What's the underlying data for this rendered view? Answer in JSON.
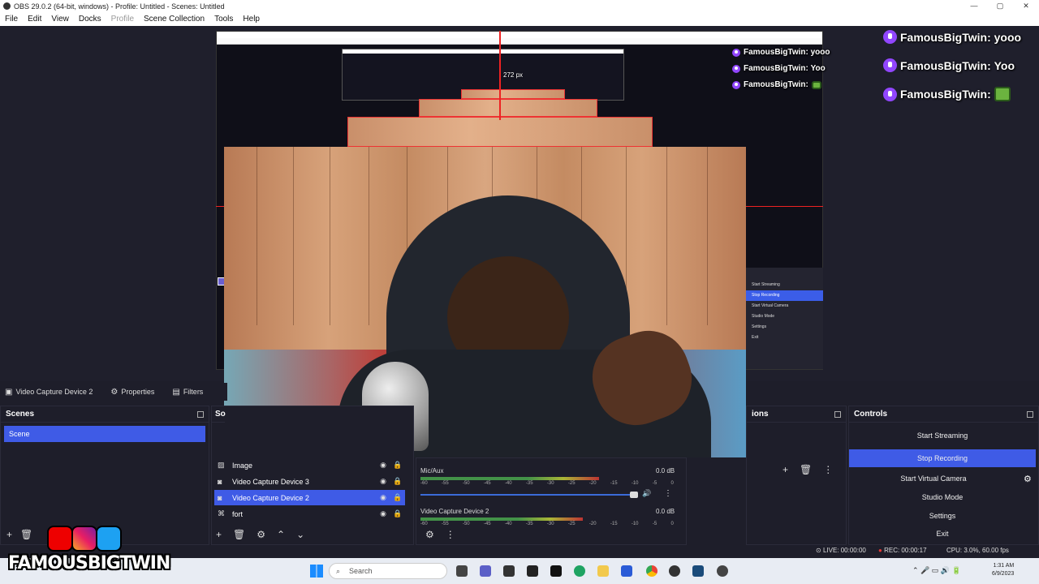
{
  "window": {
    "title": "OBS 29.0.2 (64-bit, windows) - Profile: Untitled - Scenes: Untitled",
    "buttons": [
      "—",
      "▢",
      "✕"
    ]
  },
  "menu": [
    "File",
    "Edit",
    "View",
    "Docks",
    "Profile",
    "Scene Collection",
    "Tools",
    "Help"
  ],
  "preview": {
    "measure_label": "272 px",
    "chat_big": [
      {
        "user": "FamousBigTwin:",
        "msg": "yooo"
      },
      {
        "user": "FamousBigTwin:",
        "msg": "Yoo"
      },
      {
        "user": "FamousBigTwin:",
        "msg": ""
      }
    ],
    "chat_small": [
      {
        "user": "FamousBigTwin:",
        "msg": "yooo"
      },
      {
        "user": "FamousBigTwin:",
        "msg": "Yoo"
      },
      {
        "user": "FamousBigTwin:",
        "msg": ""
      }
    ],
    "mini_controls": [
      "Start Streaming",
      "Stop Recording",
      "Start Virtual Camera",
      "Studio Mode",
      "Settings",
      "Exit"
    ]
  },
  "source_toolbar": {
    "selected_source": "Video Capture Device 2",
    "properties": "Properties",
    "filters": "Filters"
  },
  "scenes": {
    "title": "Scenes",
    "items": [
      "Scene"
    ]
  },
  "sources": {
    "title": "So",
    "items": [
      {
        "name": "Image",
        "icon": "image-icon",
        "selected": false
      },
      {
        "name": "Video Capture Device 3",
        "icon": "camera-icon",
        "selected": false
      },
      {
        "name": "Video Capture Device 2",
        "icon": "camera-icon",
        "selected": true
      },
      {
        "name": "fort",
        "icon": "gamepad-icon",
        "selected": false
      }
    ]
  },
  "mixer": {
    "channels": [
      {
        "name": "Mic/Aux",
        "level": "0.0 dB"
      },
      {
        "name": "Video Capture Device 2",
        "level": "0.0 dB"
      }
    ],
    "ticks": [
      "-60",
      "-55",
      "-50",
      "-45",
      "-40",
      "-35",
      "-30",
      "-25",
      "-20",
      "-15",
      "-10",
      "-5",
      "0"
    ]
  },
  "transitions": {
    "title": "ions"
  },
  "controls": {
    "title": "Controls",
    "buttons": [
      "Start Streaming",
      "Stop Recording",
      "Start Virtual Camera",
      "Studio Mode",
      "Settings",
      "Exit"
    ]
  },
  "status": {
    "live": "LIVE: 00:00:00",
    "rec": "REC: 00:00:17",
    "cpu": "CPU: 3.0%, 60.00 fps"
  },
  "overlay": {
    "brand": "FAMOUSBIGTWIN"
  },
  "taskbar": {
    "search_placeholder": "Search",
    "time": "1:31 AM",
    "date": "6/9/2023"
  },
  "colors": {
    "accent": "#3f5be6",
    "twitch": "#9146ff",
    "rec_dot": "#e53935"
  }
}
